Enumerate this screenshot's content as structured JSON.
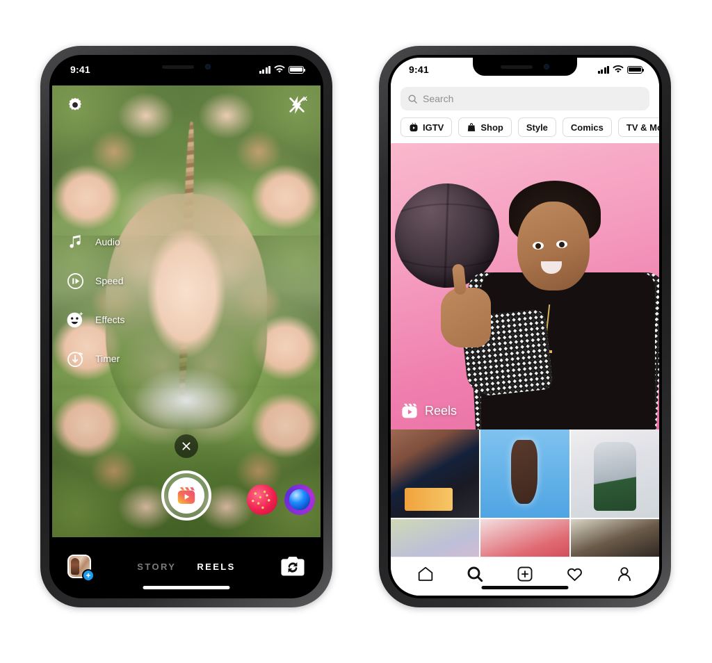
{
  "left_phone": {
    "status_bar": {
      "time": "9:41",
      "signal_icon": "cellular-bars-icon",
      "wifi_icon": "wifi-icon",
      "battery_icon": "battery-full-icon"
    },
    "camera": {
      "settings_icon": "settings-gear-icon",
      "flash_icon": "flash-off-icon",
      "flash_badge": "x",
      "close_icon": "close-x-icon",
      "menu": [
        {
          "label": "Audio",
          "icon": "music-note-icon"
        },
        {
          "label": "Speed",
          "icon": "speed-gauge-icon"
        },
        {
          "label": "Effects",
          "icon": "smiley-face-icon"
        },
        {
          "label": "Timer",
          "icon": "timer-clock-icon"
        }
      ],
      "cancel_icon": "close-x-icon",
      "shutter_icon": "reels-clapper-icon",
      "effects": [
        {
          "name": "sparkle-effect-thumbnail"
        },
        {
          "name": "blue-gem-effect-thumbnail"
        }
      ],
      "gallery_icon": "gallery-thumbnail",
      "gallery_add_badge": "+",
      "modes": [
        {
          "label": "STORY",
          "active": false
        },
        {
          "label": "REELS",
          "active": true
        }
      ],
      "flip_camera_icon": "flip-camera-icon"
    }
  },
  "right_phone": {
    "status_bar": {
      "time": "9:41",
      "signal_icon": "cellular-bars-icon",
      "wifi_icon": "wifi-icon",
      "battery_icon": "battery-full-icon"
    },
    "explore": {
      "search": {
        "placeholder": "Search",
        "value": "",
        "icon": "search-icon"
      },
      "chips": [
        {
          "label": "IGTV",
          "icon": "igtv-icon"
        },
        {
          "label": "Shop",
          "icon": "shopping-bag-icon"
        },
        {
          "label": "Style",
          "icon": ""
        },
        {
          "label": "Comics",
          "icon": ""
        },
        {
          "label": "TV & Movies",
          "icon": ""
        }
      ],
      "feature": {
        "badge_label": "Reels",
        "badge_icon": "reels-clapper-icon"
      },
      "grid_items": [
        {
          "name": "grid-item-1"
        },
        {
          "name": "grid-item-2"
        },
        {
          "name": "grid-item-3"
        },
        {
          "name": "grid-item-4"
        },
        {
          "name": "grid-item-5"
        },
        {
          "name": "grid-item-6"
        }
      ],
      "tabbar": [
        {
          "icon": "home-icon",
          "active": false
        },
        {
          "icon": "search-icon",
          "active": true
        },
        {
          "icon": "add-post-icon",
          "active": false
        },
        {
          "icon": "heart-icon",
          "active": false
        },
        {
          "icon": "profile-icon",
          "active": false
        }
      ]
    }
  },
  "colors": {
    "instagram_pink": "#e1306c",
    "instagram_orange": "#f77737",
    "accent_blue": "#1e9bf0",
    "feature_bg": "#f59fc0"
  }
}
